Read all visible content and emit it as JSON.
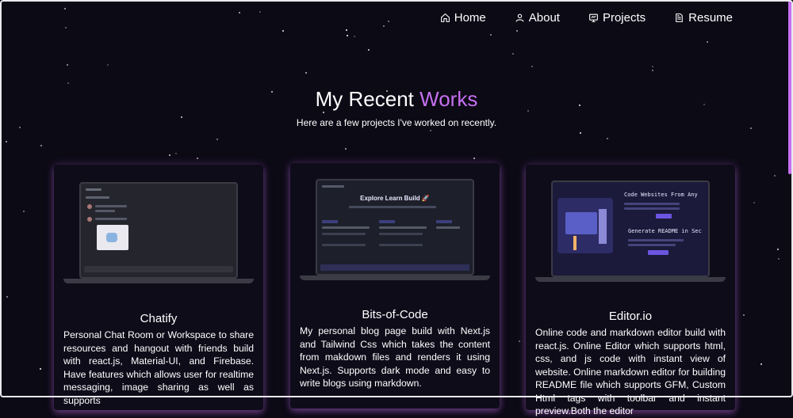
{
  "nav": {
    "items": [
      {
        "label": "Home",
        "icon": "home-icon"
      },
      {
        "label": "About",
        "icon": "user-icon"
      },
      {
        "label": "Projects",
        "icon": "projects-icon"
      },
      {
        "label": "Resume",
        "icon": "document-icon"
      }
    ]
  },
  "header": {
    "title_plain": "My Recent",
    "title_accent": "Works",
    "subtitle": "Here are a few projects I've worked on recently."
  },
  "projects": [
    {
      "title": "Chatify",
      "description": "Personal Chat Room or Workspace to share resources and hangout with friends build with react.js, Material-UI, and Firebase. Have features which allows user for realtime messaging, image sharing as well as supports"
    },
    {
      "title": "Bits-of-Code",
      "description": "My personal blog page build with Next.js and Tailwind Css which takes the content from makdown files and renders it using Next.js. Supports dark mode and easy to write blogs using markdown.",
      "screen_heading": "Explore Learn Build 🚀"
    },
    {
      "title": "Editor.io",
      "description": "Online code and markdown editor build with react.js. Online Editor which supports html, css, and js code with instant view of website. Online markdown editor for building README file which supports GFM, Custom Html tags with toolbar and instant preview.Both the editor",
      "screen_line_1": "Code Websites From Any",
      "screen_line_2": "Generate README in Sec"
    }
  ],
  "colors": {
    "accent": "#c770f0",
    "background": "#0c0a15"
  }
}
